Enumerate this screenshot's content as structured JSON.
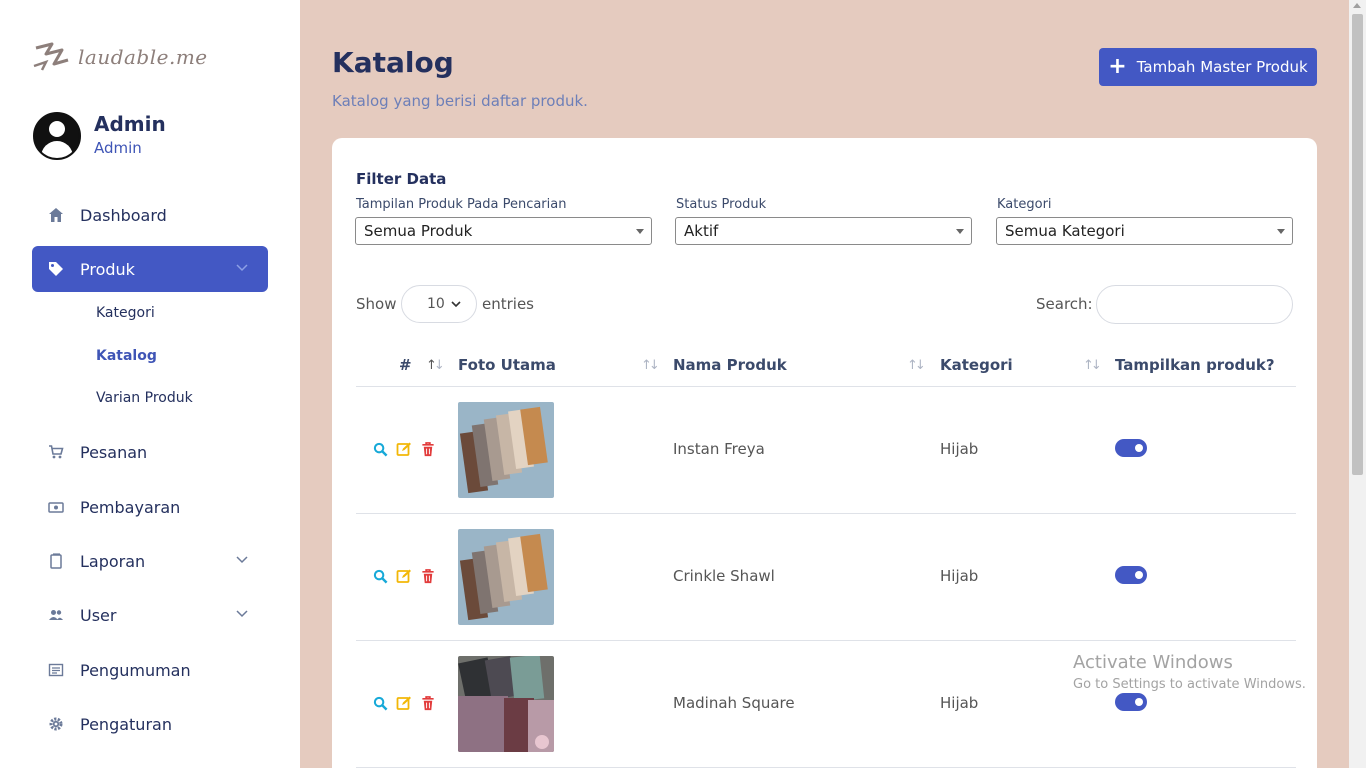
{
  "brand": {
    "logo_text": "laudable.me"
  },
  "profile": {
    "name": "Admin",
    "role": "Admin"
  },
  "sidebar": {
    "items": [
      {
        "label": "Dashboard",
        "icon": "home-icon"
      },
      {
        "label": "Produk",
        "icon": "tag-icon",
        "active": true
      },
      {
        "label": "Pesanan",
        "icon": "cart-icon"
      },
      {
        "label": "Pembayaran",
        "icon": "money-icon"
      },
      {
        "label": "Laporan",
        "icon": "document-icon"
      },
      {
        "label": "User",
        "icon": "users-icon"
      },
      {
        "label": "Pengumuman",
        "icon": "newspaper-icon"
      },
      {
        "label": "Pengaturan",
        "icon": "gear-icon"
      }
    ],
    "sub_items": [
      {
        "label": "Kategori"
      },
      {
        "label": "Katalog",
        "active": true
      },
      {
        "label": "Varian Produk"
      }
    ]
  },
  "header": {
    "title": "Katalog",
    "subtitle": "Katalog yang berisi daftar produk.",
    "add_button": "Tambah Master Produk"
  },
  "filter": {
    "title": "Filter Data",
    "fields": [
      {
        "label": "Tampilan Produk Pada Pencarian",
        "value": "Semua Produk"
      },
      {
        "label": "Status Produk",
        "value": "Aktif"
      },
      {
        "label": "Kategori",
        "value": "Semua Kategori"
      }
    ]
  },
  "table_controls": {
    "show_label": "Show",
    "entries_value": "10",
    "entries_label": "entries",
    "search_label": "Search:",
    "search_value": ""
  },
  "table": {
    "columns": [
      "#",
      "Foto Utama",
      "Nama Produk",
      "Kategori",
      "Tampilkan produk?"
    ],
    "rows": [
      {
        "name": "Instan Freya",
        "category": "Hijab",
        "visible": true
      },
      {
        "name": "Crinkle Shawl",
        "category": "Hijab",
        "visible": true
      },
      {
        "name": "Madinah Square",
        "category": "Hijab",
        "visible": true
      }
    ]
  },
  "watermark": {
    "line1": "Activate Windows",
    "line2": "Go to Settings to activate Windows."
  },
  "colors": {
    "accent": "#4358c4",
    "background": "#e5cbbf",
    "view_icon": "#17a9d8",
    "edit_icon": "#f2b707",
    "delete_icon": "#e23c3c"
  }
}
